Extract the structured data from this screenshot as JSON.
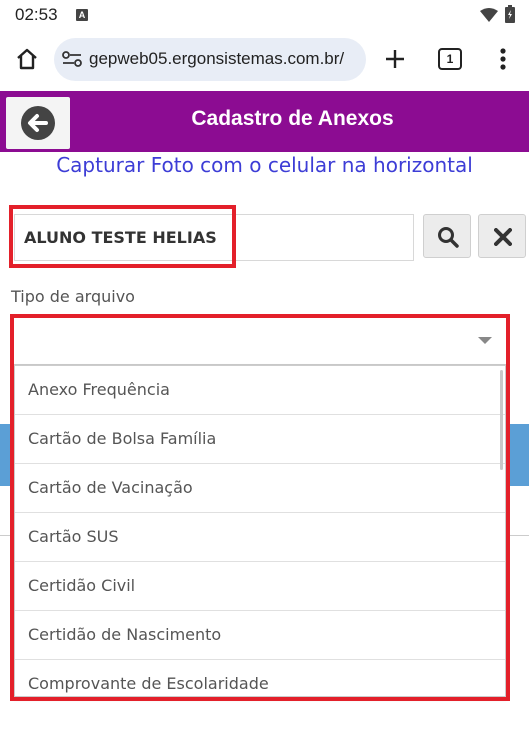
{
  "status_bar": {
    "time": "02:53",
    "notification_badge": "A"
  },
  "browser": {
    "url": "gepweb05.ergonsistemas.com.br/",
    "tab_count": "1"
  },
  "header": {
    "title": "Cadastro de Anexos"
  },
  "capture_link": "Capturar Foto com o celular na horizontal",
  "student": {
    "name": "ALUNO TESTE HELIAS"
  },
  "file_type": {
    "label": "Tipo de arquivo",
    "selected": "",
    "options": [
      "Anexo Frequência",
      "Cartão de Bolsa Família",
      "Cartão de Vacinação",
      "Cartão SUS",
      "Certidão Civil",
      "Certidão de Nascimento",
      "Comprovante de Escolaridade"
    ]
  },
  "colors": {
    "header_bg": "#8c0c92",
    "link": "#3d3dd6",
    "highlight": "#e3202a",
    "button_blue": "#5b9fd6"
  },
  "icons": {
    "home": "home-icon",
    "url_tune": "tune-icon",
    "plus": "plus-icon",
    "menu": "more-vert-icon",
    "back": "arrow-left-circle-icon",
    "search": "search-icon",
    "clear": "close-icon",
    "select": "caret-down-icon"
  }
}
